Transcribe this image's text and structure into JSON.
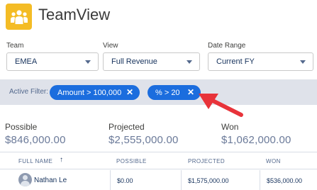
{
  "app": {
    "title": "TeamView",
    "logo_icon": "people-group-icon",
    "logo_color": "#f4bc25"
  },
  "filters": {
    "team": {
      "label": "Team",
      "value": "EMEA"
    },
    "view": {
      "label": "View",
      "value": "Full Revenue"
    },
    "date_range": {
      "label": "Date Range",
      "value": "Current FY"
    }
  },
  "active_filters": {
    "label": "Active Filter:",
    "pills": [
      {
        "label": "Amount > 100,000"
      },
      {
        "label": "% > 20"
      }
    ],
    "pill_color": "#1b6dde",
    "remove_icon": "close-icon"
  },
  "annotation": {
    "icon": "red-arrow-pointer-icon",
    "color": "#e8333a"
  },
  "metrics": [
    {
      "label": "Possible",
      "value": "$846,000.00"
    },
    {
      "label": "Projected",
      "value": "$2,555,000.00"
    },
    {
      "label": "Won",
      "value": "$1,062,000.00"
    }
  ],
  "table": {
    "columns": [
      {
        "label": "FULL NAME",
        "sort": "ascending"
      },
      {
        "label": "POSSIBLE"
      },
      {
        "label": "PROJECTED"
      },
      {
        "label": "WON"
      }
    ],
    "rows": [
      {
        "full_name": "Nathan Le",
        "possible": "$0.00",
        "projected": "$1,575,000.00",
        "won": "$536,000.00"
      }
    ]
  }
}
